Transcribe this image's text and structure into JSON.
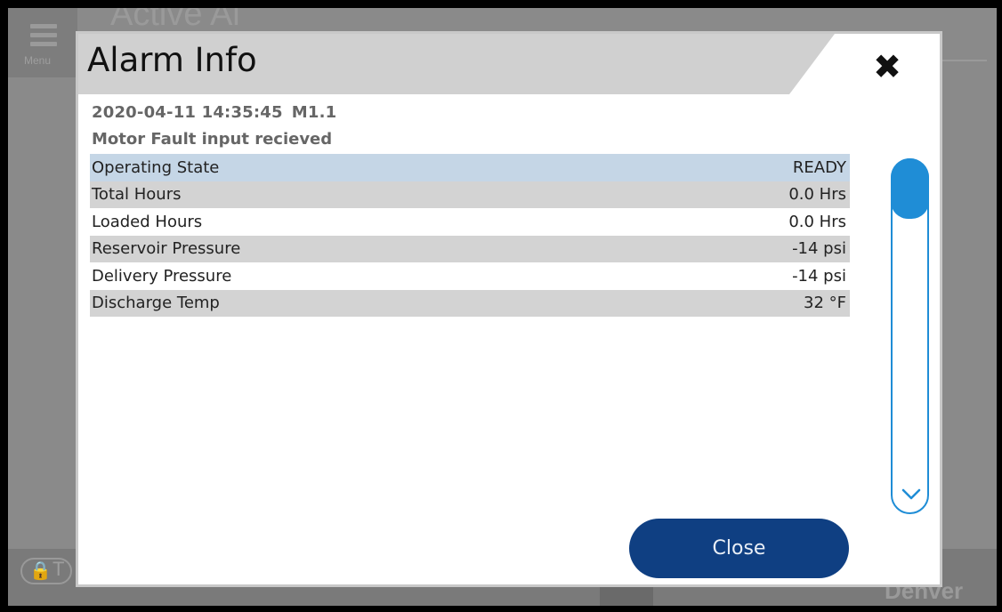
{
  "background": {
    "menu_label": "Menu",
    "title": "Active Al",
    "lock_text": "T",
    "brand": "Denver"
  },
  "dialog": {
    "title": "Alarm Info",
    "close_icon": "close-x-icon",
    "timestamp": "2020-04-11 14:35:45",
    "code": "M1.1",
    "message": "Motor Fault input recieved",
    "rows": [
      {
        "label": "Operating State",
        "value": "READY"
      },
      {
        "label": "Total Hours",
        "value": "0.0 Hrs"
      },
      {
        "label": "Loaded Hours",
        "value": "0.0 Hrs"
      },
      {
        "label": "Reservoir Pressure",
        "value": "-14 psi"
      },
      {
        "label": "Delivery Pressure",
        "value": "-14 psi"
      },
      {
        "label": "Discharge Temp",
        "value": "32 °F"
      }
    ],
    "close_button": "Close"
  },
  "colors": {
    "accent": "#1f8dd6",
    "button": "#0f3f82",
    "selected_row": "#c5d6e6",
    "alt_row": "#d3d3d3"
  }
}
